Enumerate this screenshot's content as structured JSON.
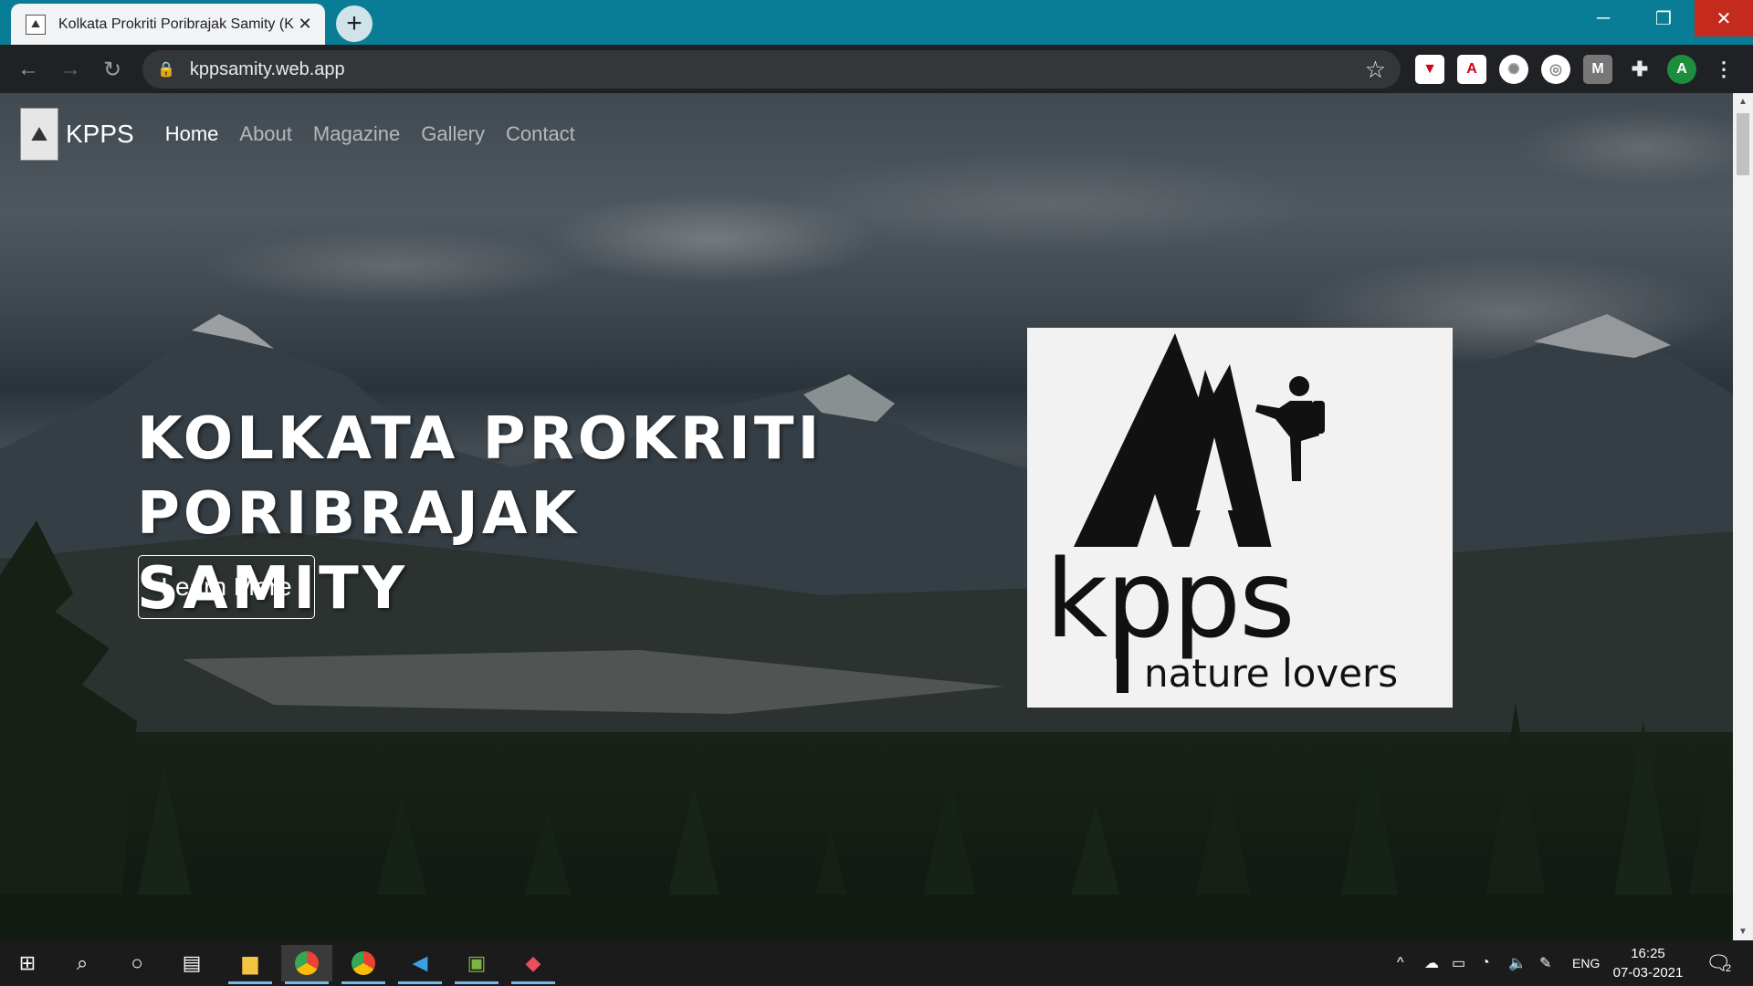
{
  "browser": {
    "tab_title": "Kolkata Prokriti Poribrajak Samity (K",
    "url": "kppsamity.web.app",
    "new_tab_icon": "plus-icon",
    "profile_initial": "A"
  },
  "site": {
    "brand": "KPPS",
    "nav": [
      {
        "label": "Home",
        "active": true
      },
      {
        "label": "About",
        "active": false
      },
      {
        "label": "Magazine",
        "active": false
      },
      {
        "label": "Gallery",
        "active": false
      },
      {
        "label": "Contact",
        "active": false
      }
    ],
    "hero": {
      "title_line1": "Kolkata Prokriti",
      "title_line2": "Poribrajak Samity",
      "button": "Learn More"
    },
    "logo": {
      "wordmark": "kpps",
      "tagline": "nature lovers"
    }
  },
  "taskbar": {
    "language": "ENG",
    "time": "16:25",
    "date": "07-03-2021",
    "notification_count": "2"
  },
  "colors": {
    "titlebar": "#0a7d96",
    "toolbar": "#202124",
    "close_button": "#c42b1c"
  }
}
